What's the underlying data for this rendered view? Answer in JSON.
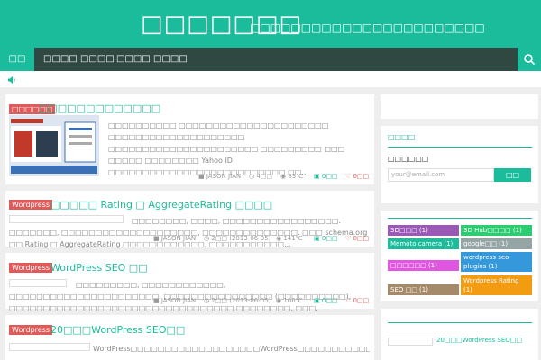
{
  "header": {
    "site_title": "□□□□□□□",
    "site_description": "□□□□□□□□□□□□□□□□□□□□□□□",
    "accent_color": "#1abc9c"
  },
  "nav": {
    "home_label": "□□",
    "items": [
      "□□□□",
      "□□□□",
      "□□□□",
      "□□□□"
    ],
    "search_icon": "search-icon"
  },
  "notice": {
    "icon": "speaker-icon"
  },
  "posts": [
    {
      "category": "□□□□□□",
      "title": "□□□□□□□□□□□□□",
      "excerpt": "□□□□□□□□□□ □□□□□□□□□□□□□□□□□□□□□□ □□□□□□□□□□□□□□□□□□□□ □□□□□□□□□□□□□□□□□□□□□□ □□□□□□□□□ □□□ □□□□□ □□□□□□□□ Yahoo ID □□□□□□□□□□□□□□□□□□□□□□□□□□ □□...",
      "author": "JASON JIAN",
      "time": "4□□",
      "views": "83℃",
      "comments": "0□□",
      "likes": "0□□"
    },
    {
      "category": "Wordpress",
      "title": "□□□□□ Rating □ AggregateRating □□□□",
      "excerpt": "□□□□□□□□, □□□□, □□□□□□□□□□□□□□□□□. □□□□□□□, □□□□□□□□□□□□□□□□□□□□, □□□□□□□□□□□□□□. □□□ schema.org □□ Rating □ AggregateRating □□□□□□□□□□□□, □□□□□□□□□□□...",
      "author": "JASON JIAN",
      "time": "2□□ (2013-06-05)",
      "views": "141℃",
      "comments": "0□□",
      "likes": "0□□"
    },
    {
      "category": "Wordpress",
      "title": "WordPress SEO □□",
      "excerpt": "□□□□□□□□□, □□□□□□□□□□□□, □□□□□□□□□□□□□□□□□□□□□□. □□□□□□□□□□□□□□□□ (□□□□□□□□□□), □□□□□□□□□□□□□□□□□□□□□□□□□□□□□□□□□ □□□□□□□□. □□□, □□□□□□□□□□□□□□□□, □□...",
      "author": "JASON JIAN",
      "time": "2□□ (2013-06-05)",
      "views": "106℃",
      "comments": "0□□",
      "likes": "0□□"
    },
    {
      "category": "Wordpress",
      "title": "20□□□WordPress SEO□□",
      "excerpt": "WordPress□□□□□□□□□□□□□□□□□□□WordPress□□□□□□□□□□□□□□□□□□□□□□□□□□□□□□□□□□□□□□□□□□□□□□□□□□□□□□□□□□□□□□□□□□□□□□□□□□□□□□□□□□□□WordPress□□□□□□□□□□..."
    }
  ],
  "sidebar": {
    "subscribe": {
      "title": "□□□□",
      "label": "□□□□□□",
      "email_placeholder": "your@email.com",
      "button_label": "□□"
    },
    "tags": [
      {
        "label": "3D□□□ (1)",
        "color": "#9b59b6"
      },
      {
        "label": "3D Hub□□□□ (1)",
        "color": "#2ecc71"
      },
      {
        "label": "Memoto camera (1)",
        "color": "#1abc9c"
      },
      {
        "label": "google□□ (1)",
        "color": "#95a5a6"
      },
      {
        "label": "□□□□□□ (1)",
        "color": "#e056e0"
      },
      {
        "label": "wordpress seo plugins (1)",
        "color": "#3498db"
      },
      {
        "label": "SEO □□ (1)",
        "color": "#a58a6a"
      },
      {
        "label": "Wordpress Rating (1)",
        "color": "#f39c12"
      }
    ],
    "recent": [
      {
        "title": "20□□□WordPress SEO□□"
      }
    ]
  }
}
